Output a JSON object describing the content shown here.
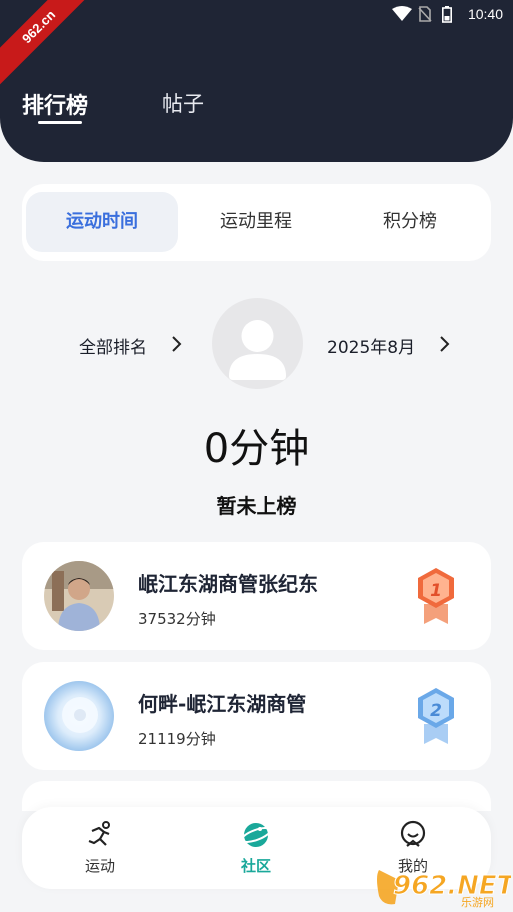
{
  "status_bar": {
    "time": "10:40"
  },
  "corner_badge": "962.cn",
  "header": {
    "tabs": [
      {
        "label": "排行榜"
      },
      {
        "label": "帖子"
      }
    ]
  },
  "segments": [
    {
      "label": "运动时间"
    },
    {
      "label": "运动里程"
    },
    {
      "label": "积分榜"
    }
  ],
  "filters": {
    "scope_label": "全部排名",
    "month_label": "2025年8月"
  },
  "me": {
    "total": "0分钟",
    "status": "暂未上榜"
  },
  "leaderboard": [
    {
      "name": "岷江东湖商管张纪东",
      "minutes": "37532分钟",
      "rank": "1",
      "medal_color": "#f06a3c"
    },
    {
      "name": "何畔-岷江东湖商管",
      "minutes": "21119分钟",
      "rank": "2",
      "medal_color": "#6aa8e8"
    }
  ],
  "bottom_nav": [
    {
      "label": "运动",
      "icon": "running-icon"
    },
    {
      "label": "社区",
      "icon": "planet-icon"
    },
    {
      "label": "我的",
      "icon": "profile-icon"
    }
  ],
  "watermark": {
    "brand": "962.NET",
    "sub": "乐游网"
  },
  "colors": {
    "header_bg": "#1f2535",
    "accent_blue": "#3a6fdd",
    "accent_teal": "#1aa89a"
  }
}
